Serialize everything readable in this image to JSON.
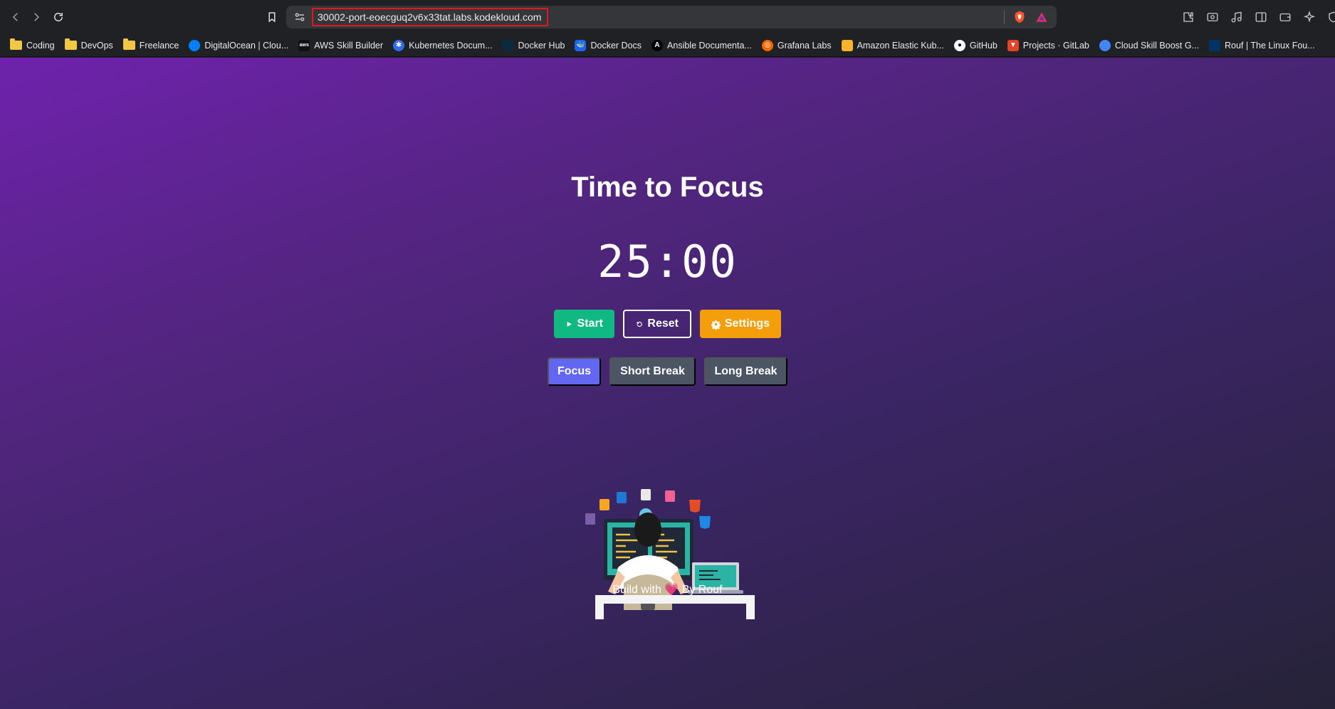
{
  "browser": {
    "url": "30002-port-eoecguq2v6x33tat.labs.kodekloud.com",
    "bookmarks": [
      {
        "label": "Coding",
        "icon": "folder-icon"
      },
      {
        "label": "DevOps",
        "icon": "folder-icon"
      },
      {
        "label": "Freelance",
        "icon": "folder-icon"
      },
      {
        "label": "DigitalOcean | Clou...",
        "icon": "digitalocean-icon"
      },
      {
        "label": "AWS Skill Builder",
        "icon": "aws-icon"
      },
      {
        "label": "Kubernetes Docum...",
        "icon": "kubernetes-icon"
      },
      {
        "label": "Docker Hub",
        "icon": "docker-icon"
      },
      {
        "label": "Docker Docs",
        "icon": "docker-icon"
      },
      {
        "label": "Ansible Documenta...",
        "icon": "ansible-icon"
      },
      {
        "label": "Grafana Labs",
        "icon": "grafana-icon"
      },
      {
        "label": "Amazon Elastic Kub...",
        "icon": "aws-box-icon"
      },
      {
        "label": "GitHub",
        "icon": "github-icon"
      },
      {
        "label": "Projects · GitLab",
        "icon": "gitlab-icon"
      },
      {
        "label": "Cloud Skill Boost G...",
        "icon": "google-cloud-icon"
      },
      {
        "label": "Rouf | The Linux Fou...",
        "icon": "linux-foundation-icon"
      }
    ]
  },
  "app": {
    "title": "Time to Focus",
    "timer": "25:00",
    "controls": {
      "start": "Start",
      "reset": "Reset",
      "settings": "Settings"
    },
    "modes": {
      "focus": "Focus",
      "short_break": "Short Break",
      "long_break": "Long Break",
      "active": "Focus"
    },
    "footer": {
      "prefix": "Build with",
      "heart": "💗",
      "suffix": "By Rouf"
    }
  },
  "colors": {
    "start": "#10b981",
    "settings": "#f59e0b",
    "mode_active": "#6366f1",
    "mode_inactive": "#4b5563",
    "url_highlight": "#e0191f"
  }
}
